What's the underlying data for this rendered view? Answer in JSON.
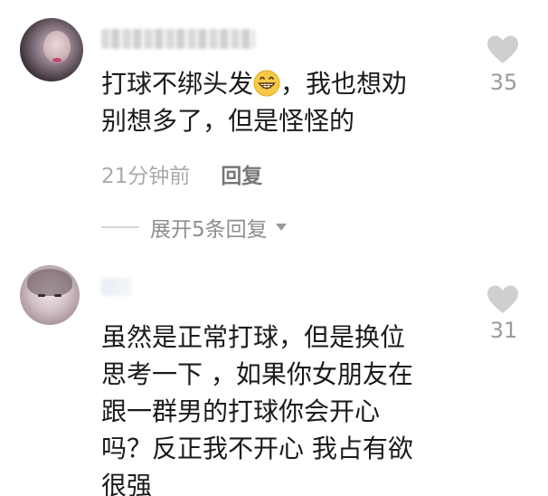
{
  "comments": [
    {
      "text_line1_before_emoji": "打球不绑头发",
      "emoji": "grinning-face-icon",
      "text_line1_after_emoji": "，我也想劝",
      "text_line2": "别想多了，但是怪怪的",
      "like_count": "35",
      "timestamp": "21分钟前",
      "reply_label": "回复",
      "expand_replies_label": "展开5条回复"
    },
    {
      "text_lines": [
        "虽然是正常打球，但是换位",
        "思考一下 ，如果你女朋友在",
        "跟一群男的打球你会开心",
        "吗？反正我不开心 我占有欲",
        "很强"
      ],
      "like_count": "31"
    }
  ],
  "colors": {
    "text": "#1a1a1a",
    "meta_gray": "#9a9a9a",
    "reply_gray": "#777777",
    "like_icon": "#cfcfcf",
    "emoji_yellow": "#f7c948"
  }
}
